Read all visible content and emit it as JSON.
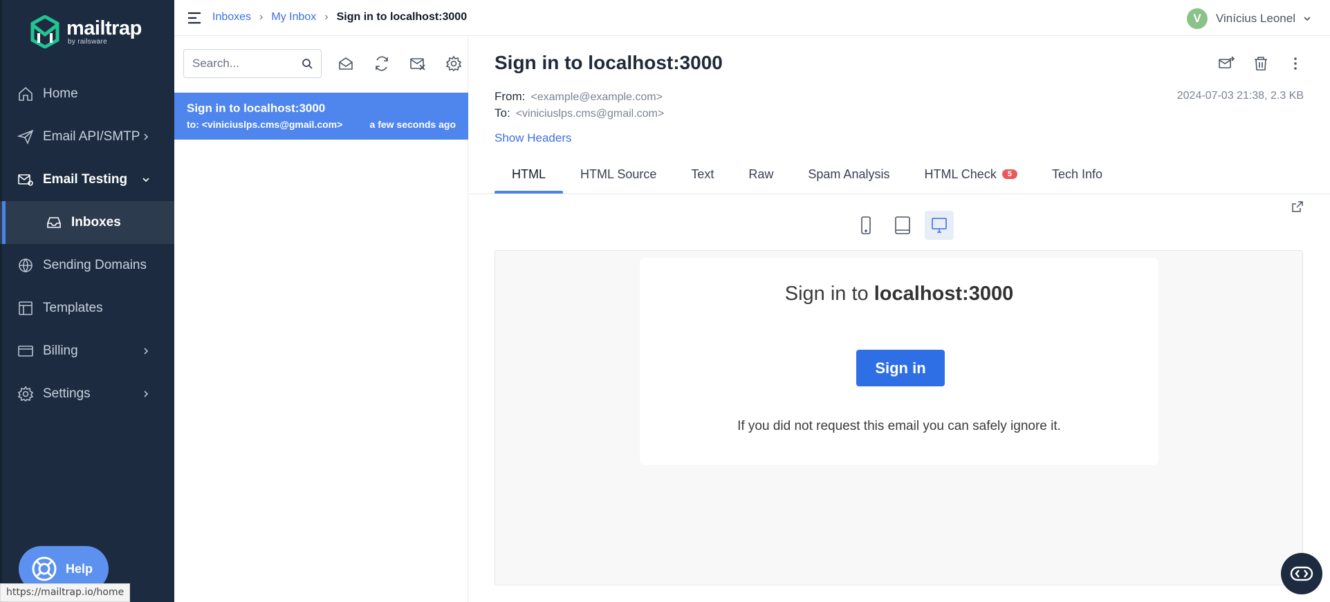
{
  "brand": {
    "name": "mailtrap",
    "byline": "by railsware"
  },
  "nav": {
    "home": "Home",
    "email_api": "Email API/SMTP",
    "email_testing": "Email Testing",
    "inboxes": "Inboxes",
    "sending_domains": "Sending Domains",
    "templates": "Templates",
    "billing": "Billing",
    "settings": "Settings"
  },
  "help": {
    "label": "Help"
  },
  "status_url": "https://mailtrap.io/home",
  "breadcrumb": {
    "inboxes": "Inboxes",
    "my_inbox": "My Inbox",
    "current": "Sign in to localhost:3000"
  },
  "user": {
    "initial": "V",
    "name": "Vinícius Leonel"
  },
  "search": {
    "placeholder": "Search..."
  },
  "messages": [
    {
      "subject": "Sign in to localhost:3000",
      "to": "to: <viniciuslps.cms@gmail.com>",
      "time": "a few seconds ago"
    }
  ],
  "email": {
    "subject": "Sign in to localhost:3000",
    "from_label": "From:",
    "from": "<example@example.com>",
    "to_label": "To:",
    "to": "<viniciuslps.cms@gmail.com>",
    "meta": "2024-07-03 21:38, 2.3 KB",
    "show_headers": "Show Headers"
  },
  "tabs": [
    {
      "label": "HTML"
    },
    {
      "label": "HTML Source"
    },
    {
      "label": "Text"
    },
    {
      "label": "Raw"
    },
    {
      "label": "Spam Analysis"
    },
    {
      "label": "HTML Check",
      "badge": "5"
    },
    {
      "label": "Tech Info"
    }
  ],
  "preview": {
    "title_prefix": "Sign in to ",
    "title_host": "localhost:3000",
    "button": "Sign in",
    "note": "If you did not request this email you can safely ignore it."
  },
  "colors": {
    "sidebar": "#1c2b3f",
    "accent": "#4c83e8",
    "selected_row": "#4f86ed",
    "button": "#2f6fe6",
    "badge": "#e85a5a"
  }
}
